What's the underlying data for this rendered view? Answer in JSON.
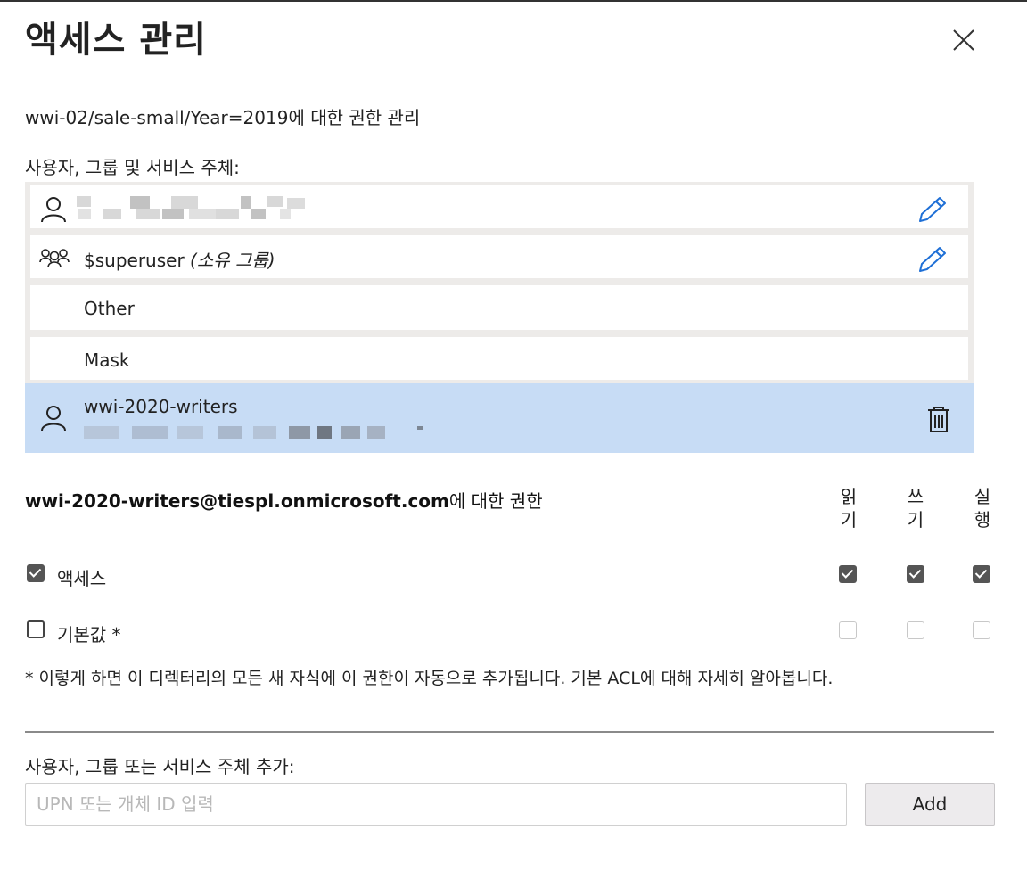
{
  "dialog": {
    "title": "액세스 관리",
    "close_icon": "close-icon"
  },
  "subtitle": "wwi-02/sale-small/Year=2019에 대한 권한 관리",
  "principals": {
    "label": "사용자, 그룹 및 서비스 주체:",
    "items": [
      {
        "icon": "user-icon",
        "name": "",
        "redacted": true,
        "action_icon": "edit-pencil-icon"
      },
      {
        "icon": "group-icon",
        "name": "$superuser",
        "suffix": "(소유 그룹)",
        "action_icon": "edit-pencil-icon"
      },
      {
        "name": "Other"
      },
      {
        "name": "Mask"
      },
      {
        "icon": "user-icon",
        "name": "wwi-2020-writers",
        "selected": true,
        "action_icon": "trash-icon"
      }
    ]
  },
  "permissions": {
    "principal": "wwi-2020-writers@tiespl.onmicrosoft.com",
    "title_suffix": "에 대한 권한",
    "columns": [
      {
        "line1": "읽",
        "line2": "기"
      },
      {
        "line1": "쓰",
        "line2": "기"
      },
      {
        "line1": "실",
        "line2": "행"
      }
    ],
    "rows": [
      {
        "label": "액세스",
        "checked": true,
        "read": true,
        "write": true,
        "execute": true
      },
      {
        "label": "기본값 *",
        "checked": false,
        "read": false,
        "write": false,
        "execute": false
      }
    ],
    "note": "* 이렇게 하면 이 디렉터리의 모든 새 자식에 이 권한이 자동으로 추가됩니다. 기본 ACL에 대해 자세히 알아봅니다."
  },
  "add": {
    "label": "사용자, 그룹 또는 서비스 주체 추가:",
    "placeholder": "UPN 또는 개체 ID 입력",
    "button_label": "Add"
  },
  "colors": {
    "selected_row": "#c7dcf5",
    "edit_icon": "#1e6fd6",
    "checkbox_checked": "#555555"
  }
}
